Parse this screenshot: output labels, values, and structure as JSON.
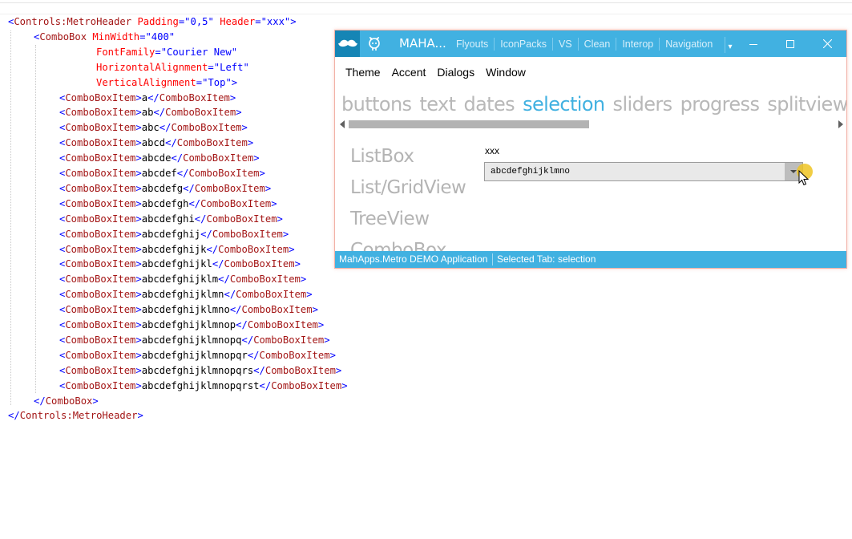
{
  "code": {
    "lines": [
      {
        "indent": 0,
        "kind": "open",
        "tag": "Controls:MetroHeader",
        "attrs": [
          {
            "name": "Padding",
            "value": "\"0,5\""
          },
          {
            "name": "Header",
            "value": "\"xxx\""
          }
        ],
        "close": ">"
      },
      {
        "indent": 1,
        "kind": "open",
        "tag": "ComboBox",
        "attrs": [
          {
            "name": "MinWidth",
            "value": "\"400\""
          }
        ],
        "close": ""
      },
      {
        "indent": 2,
        "kind": "attr",
        "name": "FontFamily",
        "value": "\"Courier New\"",
        "close": ""
      },
      {
        "indent": 2,
        "kind": "attr",
        "name": "HorizontalAlignment",
        "value": "\"Left\"",
        "close": ""
      },
      {
        "indent": 2,
        "kind": "attr",
        "name": "VerticalAlignment",
        "value": "\"Top\"",
        "close": ">"
      },
      {
        "indent": 2,
        "kind": "item",
        "tag": "ComboBoxItem",
        "text": "a"
      },
      {
        "indent": 2,
        "kind": "item",
        "tag": "ComboBoxItem",
        "text": "ab"
      },
      {
        "indent": 2,
        "kind": "item",
        "tag": "ComboBoxItem",
        "text": "abc"
      },
      {
        "indent": 2,
        "kind": "item",
        "tag": "ComboBoxItem",
        "text": "abcd"
      },
      {
        "indent": 2,
        "kind": "item",
        "tag": "ComboBoxItem",
        "text": "abcde"
      },
      {
        "indent": 2,
        "kind": "item",
        "tag": "ComboBoxItem",
        "text": "abcdef"
      },
      {
        "indent": 2,
        "kind": "item",
        "tag": "ComboBoxItem",
        "text": "abcdefg"
      },
      {
        "indent": 2,
        "kind": "item",
        "tag": "ComboBoxItem",
        "text": "abcdefgh"
      },
      {
        "indent": 2,
        "kind": "item",
        "tag": "ComboBoxItem",
        "text": "abcdefghi"
      },
      {
        "indent": 2,
        "kind": "item",
        "tag": "ComboBoxItem",
        "text": "abcdefghij"
      },
      {
        "indent": 2,
        "kind": "item",
        "tag": "ComboBoxItem",
        "text": "abcdefghijk"
      },
      {
        "indent": 2,
        "kind": "item",
        "tag": "ComboBoxItem",
        "text": "abcdefghijkl"
      },
      {
        "indent": 2,
        "kind": "item",
        "tag": "ComboBoxItem",
        "text": "abcdefghijklm"
      },
      {
        "indent": 2,
        "kind": "item",
        "tag": "ComboBoxItem",
        "text": "abcdefghijklmn"
      },
      {
        "indent": 2,
        "kind": "item",
        "tag": "ComboBoxItem",
        "text": "abcdefghijklmno"
      },
      {
        "indent": 2,
        "kind": "item",
        "tag": "ComboBoxItem",
        "text": "abcdefghijklmnop"
      },
      {
        "indent": 2,
        "kind": "item",
        "tag": "ComboBoxItem",
        "text": "abcdefghijklmnopq"
      },
      {
        "indent": 2,
        "kind": "item",
        "tag": "ComboBoxItem",
        "text": "abcdefghijklmnopqr"
      },
      {
        "indent": 2,
        "kind": "item",
        "tag": "ComboBoxItem",
        "text": "abcdefghijklmnopqrs"
      },
      {
        "indent": 2,
        "kind": "item",
        "tag": "ComboBoxItem",
        "text": "abcdefghijklmnopqrst"
      },
      {
        "indent": 1,
        "kind": "end",
        "tag": "ComboBox"
      },
      {
        "indent": 0,
        "kind": "end",
        "tag": "Controls:MetroHeader"
      }
    ]
  },
  "window": {
    "title": "MAHA...",
    "title_menu": [
      "Flyouts",
      "IconPacks",
      "VS",
      "Clean",
      "Interop",
      "Navigation"
    ],
    "menu": [
      "Theme",
      "Accent",
      "Dialogs",
      "Window"
    ],
    "tabs": [
      {
        "label": "buttons",
        "active": false
      },
      {
        "label": "text",
        "active": false
      },
      {
        "label": "dates",
        "active": false
      },
      {
        "label": "selection",
        "active": true
      },
      {
        "label": "sliders",
        "active": false
      },
      {
        "label": "progress",
        "active": false
      },
      {
        "label": "splitview",
        "active": false
      }
    ],
    "side_items": [
      "ListBox",
      "List/GridView",
      "TreeView",
      "ComboBox"
    ],
    "header_label": "xxx",
    "combo_value": "abcdefghijklmno",
    "status": {
      "app": "MahApps.Metro DEMO Application",
      "selected_label": "Selected Tab:",
      "selected_value": "selection"
    }
  },
  "colors": {
    "accent": "#41b1e1",
    "accent_dark": "#1585b5",
    "xml_tag": "#a31515",
    "xml_bracket": "#0000ff",
    "xml_attribute": "#ff0000",
    "xml_value": "#0000ff"
  },
  "icons": {
    "app": "mustache-icon",
    "github": "github-icon",
    "minimize": "minimize-icon",
    "maximize": "maximize-icon",
    "close": "close-icon",
    "cursor": "mouse-cursor-icon"
  }
}
